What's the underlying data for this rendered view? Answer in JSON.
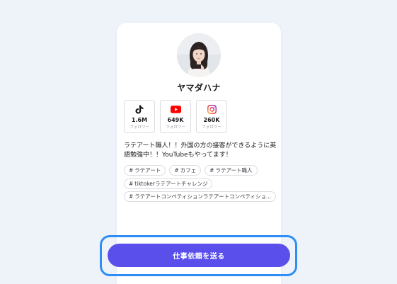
{
  "profile": {
    "name": "ヤマダハナ",
    "avatar_icon": "avatar"
  },
  "stats": [
    {
      "platform": "TikTok",
      "icon": "tiktok-icon",
      "value": "1.6M",
      "label": "フォロワー"
    },
    {
      "platform": "YouTube",
      "icon": "youtube-icon",
      "value": "649K",
      "label": "フォロワー"
    },
    {
      "platform": "Instagram",
      "icon": "instagram-icon",
      "value": "260K",
      "label": "フォロワー"
    }
  ],
  "bio": "ラテアート職人！！外国の方の接客ができるように英語勉強中！！YouTubeもやってます！",
  "tag_prefix": "#",
  "tags": [
    {
      "label": "ラテアート"
    },
    {
      "label": "カフェ"
    },
    {
      "label": "ラテアート職人"
    },
    {
      "label": "tiktokerラテアートチャレンジ"
    },
    {
      "label": "ラテアートコンペティションラテアートコンペティショ..."
    }
  ],
  "cta": {
    "label": "仕事依頼を送る"
  },
  "colors": {
    "background": "#eef3fa",
    "cta": "#5a4fea",
    "highlight": "#2f8ef5",
    "youtube": "#ff0000"
  }
}
